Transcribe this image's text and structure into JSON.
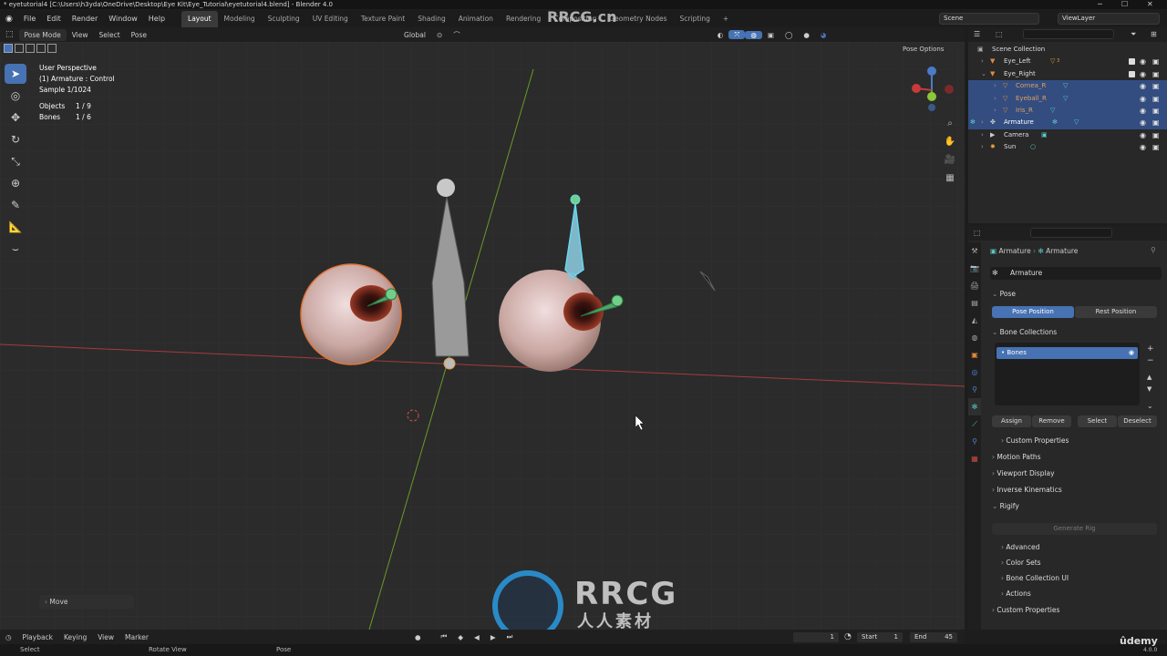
{
  "window": {
    "title": "* eyetutorial4 [C:\\Users\\h3yda\\OneDrive\\Desktop\\Eye Kit\\Eye_Tutorial\\eyetutorial4.blend] - Blender 4.0"
  },
  "menu": [
    "File",
    "Edit",
    "Render",
    "Window",
    "Help"
  ],
  "workspaces": [
    "Layout",
    "Modeling",
    "Sculpting",
    "UV Editing",
    "Texture Paint",
    "Shading",
    "Animation",
    "Rendering",
    "Compositing",
    "Geometry Nodes",
    "Scripting"
  ],
  "active_workspace": "Layout",
  "scene": {
    "name": "Scene",
    "view_layer": "ViewLayer"
  },
  "viewport_header": {
    "mode": "Pose Mode",
    "menus": [
      "View",
      "Select",
      "Pose"
    ],
    "transform": "Global",
    "pose_options": "Pose Options"
  },
  "viewport_overlay": {
    "perspective": "User Perspective",
    "active": "(1) Armature : Control",
    "sample": "Sample 1/1024",
    "objects_label": "Objects",
    "objects_value": "1 / 9",
    "bones_label": "Bones",
    "bones_value": "1 / 6"
  },
  "last_operator": "Move",
  "watermark": {
    "brand": "RRCG",
    "sub": "人人素材",
    "top": "RRCG.cn"
  },
  "outliner": {
    "search_placeholder": "",
    "rows": [
      {
        "label": "Scene Collection",
        "indent": 0,
        "selected": false,
        "type": "collection"
      },
      {
        "label": "Eye_Left",
        "indent": 1,
        "selected": false,
        "type": "object",
        "badge": "3"
      },
      {
        "label": "Eye_Right",
        "indent": 1,
        "selected": false,
        "type": "object"
      },
      {
        "label": "Cornea_R",
        "indent": 2,
        "selected": true,
        "type": "mesh"
      },
      {
        "label": "Eyeball_R",
        "indent": 2,
        "selected": true,
        "type": "mesh"
      },
      {
        "label": "Iris_R",
        "indent": 2,
        "selected": true,
        "type": "mesh"
      },
      {
        "label": "Armature",
        "indent": 1,
        "selected": true,
        "type": "armature"
      },
      {
        "label": "Camera",
        "indent": 1,
        "selected": false,
        "type": "camera"
      },
      {
        "label": "Sun",
        "indent": 1,
        "selected": false,
        "type": "light"
      }
    ]
  },
  "properties": {
    "breadcrumb": [
      "Armature",
      "Armature"
    ],
    "data_name": "Armature",
    "pose_section": "Pose",
    "pose_position": "Pose Position",
    "rest_position": "Rest Position",
    "bone_collections": "Bone Collections",
    "bone_collection_item": "Bones",
    "assign": "Assign",
    "remove": "Remove",
    "select": "Select",
    "deselect": "Deselect",
    "custom_properties_inner": "Custom Properties",
    "motion_paths": "Motion Paths",
    "viewport_display": "Viewport Display",
    "inverse_kinematics": "Inverse Kinematics",
    "rigify": "Rigify",
    "generate_rig": "Generate Rig",
    "advanced": "Advanced",
    "color_sets": "Color Sets",
    "bone_collection_ui": "Bone Collection UI",
    "actions": "Actions",
    "custom_properties": "Custom Properties"
  },
  "timeline": {
    "menus": [
      "Playback",
      "Keying",
      "View",
      "Marker"
    ],
    "current_frame": "1",
    "start_label": "Start",
    "start": "1",
    "end_label": "End",
    "end": "45"
  },
  "statusbar": {
    "left": "Select",
    "middle": "Rotate View",
    "right": "Pose",
    "version": "4.0.0"
  },
  "udemy": "ûdemy",
  "colors": {
    "accent": "#4772b3",
    "selected_row": "#334d80",
    "bone_green": "#5fbf7a",
    "axis_x": "#c0392b",
    "axis_y": "#6a9a2a"
  }
}
